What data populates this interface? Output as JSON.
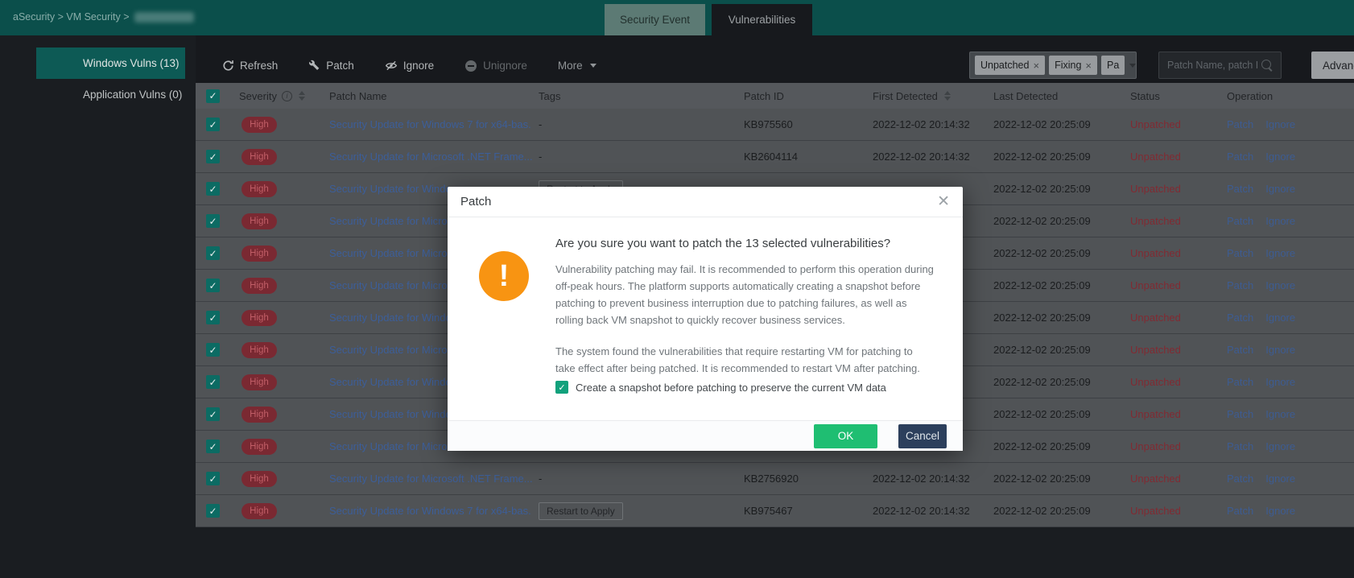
{
  "breadcrumb": {
    "path": "aSecurity > VM Security >"
  },
  "tabs": [
    {
      "label": "Security Event",
      "active": false
    },
    {
      "label": "Vulnerabilities",
      "active": true
    }
  ],
  "sidebar": {
    "items": [
      {
        "label": "Windows Vulns (13)",
        "active": true
      },
      {
        "label": "Application Vulns (0)",
        "active": false
      }
    ]
  },
  "toolbar": {
    "refresh_label": "Refresh",
    "patch_label": "Patch",
    "ignore_label": "Ignore",
    "unignore_label": "Unignore",
    "more_label": "More"
  },
  "filters": {
    "chips": [
      {
        "label": "Unpatched",
        "removable": true
      },
      {
        "label": "Fixing",
        "removable": true
      },
      {
        "label": "Pa",
        "removable": false
      }
    ],
    "search_placeholder": "Patch Name, patch ID",
    "advanced_label": "Advanced"
  },
  "table": {
    "columns": [
      "Severity",
      "Patch Name",
      "Tags",
      "Patch ID",
      "First Detected",
      "Last Detected",
      "Status",
      "Operation"
    ],
    "operations": [
      "Patch",
      "Ignore"
    ],
    "rows": [
      {
        "severity": "High",
        "patch_name": "Security Update for Windows 7 for x64-bas...",
        "tags": "-",
        "tag_style": "text",
        "patch_id": "KB975560",
        "first_detected": "2022-12-02 20:14:32",
        "last_detected": "2022-12-02 20:25:09",
        "status": "Unpatched"
      },
      {
        "severity": "High",
        "patch_name": "Security Update for Microsoft .NET Frame...",
        "tags": "-",
        "tag_style": "text",
        "patch_id": "KB2604114",
        "first_detected": "2022-12-02 20:14:32",
        "last_detected": "2022-12-02 20:25:09",
        "status": "Unpatched"
      },
      {
        "severity": "High",
        "patch_name": "Security Update for Window",
        "tags": "Restart to Apply",
        "tag_style": "outlined",
        "patch_id": "",
        "first_detected": "",
        "last_detected": "2022-12-02 20:25:09",
        "status": "Unpatched"
      },
      {
        "severity": "High",
        "patch_name": "Security Update for Microso",
        "tags": "",
        "tag_style": "text",
        "patch_id": "",
        "first_detected": "",
        "last_detected": "2022-12-02 20:25:09",
        "status": "Unpatched"
      },
      {
        "severity": "High",
        "patch_name": "Security Update for Microso",
        "tags": "",
        "tag_style": "text",
        "patch_id": "",
        "first_detected": "",
        "last_detected": "2022-12-02 20:25:09",
        "status": "Unpatched"
      },
      {
        "severity": "High",
        "patch_name": "Security Update for Microso",
        "tags": "",
        "tag_style": "text",
        "patch_id": "",
        "first_detected": "",
        "last_detected": "2022-12-02 20:25:09",
        "status": "Unpatched"
      },
      {
        "severity": "High",
        "patch_name": "Security Update for Window",
        "tags": "",
        "tag_style": "text",
        "patch_id": "",
        "first_detected": "",
        "last_detected": "2022-12-02 20:25:09",
        "status": "Unpatched"
      },
      {
        "severity": "High",
        "patch_name": "Security Update for Microso",
        "tags": "",
        "tag_style": "text",
        "patch_id": "",
        "first_detected": "",
        "last_detected": "2022-12-02 20:25:09",
        "status": "Unpatched"
      },
      {
        "severity": "High",
        "patch_name": "Security Update for Window",
        "tags": "",
        "tag_style": "text",
        "patch_id": "",
        "first_detected": "",
        "last_detected": "2022-12-02 20:25:09",
        "status": "Unpatched"
      },
      {
        "severity": "High",
        "patch_name": "Security Update for Window",
        "tags": "",
        "tag_style": "text",
        "patch_id": "",
        "first_detected": "",
        "last_detected": "2022-12-02 20:25:09",
        "status": "Unpatched"
      },
      {
        "severity": "High",
        "patch_name": "Security Update for Microso",
        "tags": "",
        "tag_style": "text",
        "patch_id": "",
        "first_detected": "",
        "last_detected": "2022-12-02 20:25:09",
        "status": "Unpatched"
      },
      {
        "severity": "High",
        "patch_name": "Security Update for Microsoft .NET Frame...",
        "tags": "-",
        "tag_style": "text",
        "patch_id": "KB2756920",
        "first_detected": "2022-12-02 20:14:32",
        "last_detected": "2022-12-02 20:25:09",
        "status": "Unpatched"
      },
      {
        "severity": "High",
        "patch_name": "Security Update for Windows 7 for x64-bas...",
        "tags": "Restart to Apply",
        "tag_style": "outlined",
        "patch_id": "KB975467",
        "first_detected": "2022-12-02 20:14:32",
        "last_detected": "2022-12-02 20:25:09",
        "status": "Unpatched"
      }
    ]
  },
  "modal": {
    "title": "Patch",
    "heading": "Are you sure you want to patch the 13 selected vulnerabilities?",
    "body1": "Vulnerability patching may fail. It is recommended to perform this operation during off-peak hours. The platform supports automatically creating a snapshot before patching to prevent business interruption due to patching failures, as well as rolling back VM snapshot to quickly recover business services.",
    "body2": "The system found the vulnerabilities that require restarting VM for patching to take effect after being patched. It is recommended to restart VM after patching.",
    "checkbox_label": "Create a snapshot before patching to preserve the current VM data",
    "ok_label": "OK",
    "cancel_label": "Cancel"
  },
  "colors": {
    "brand_teal": "#0b4f4b",
    "sidebar_active_teal": "#0d5a55",
    "ok_green": "#1fbe72",
    "cancel_navy": "#2c3f5c",
    "warning_orange": "#f89412",
    "severity_red": "#7a2932",
    "status_red": "#812a32",
    "link_blue": "#3c5e99"
  }
}
